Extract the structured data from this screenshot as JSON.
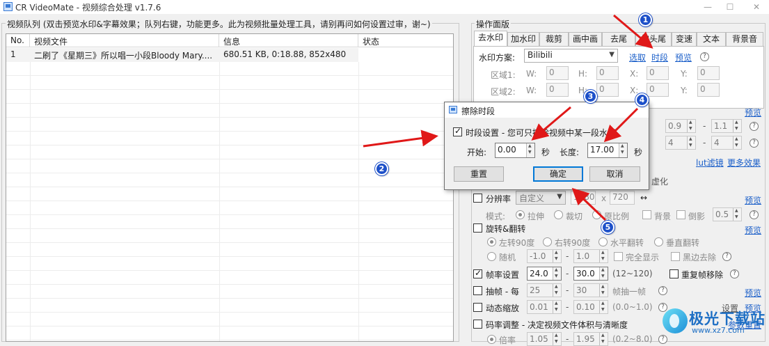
{
  "window": {
    "title": "CR VideoMate - 视频综合处理 v1.7.6",
    "minimize": "—",
    "maximize": "☐",
    "close": "✕"
  },
  "queue": {
    "title": "视频队列 (双击预览水印&字幕效果；队列右键，功能更多。此为视频批量处理工具，请别再问如何设置过审，谢~)",
    "columns": [
      "No.",
      "视频文件",
      "信息",
      "状态"
    ],
    "rows": [
      {
        "no": "1",
        "file": "二刷了《星期三》所以唱一小段Bloody Mary....",
        "info": "680.51 KB, 0:18.88, 852x480",
        "status": ""
      }
    ]
  },
  "ops": {
    "title": "操作面版",
    "tabs": [
      "去水印",
      "加水印",
      "裁剪",
      "画中画",
      "去尾",
      "加头尾",
      "变速",
      "文本",
      "背景音"
    ],
    "active_tab": "去水印",
    "watermark": {
      "scheme_label": "水印方案:",
      "scheme_value": "Bilibili",
      "pick_link": "选取",
      "period_link": "时段",
      "preview_link": "预览",
      "area1_label": "区域1:",
      "area2_label": "区域2:",
      "w_label": "W:",
      "h_label": "H:",
      "x_label": "X:",
      "y_label": "Y:",
      "zero": "0"
    },
    "preview": "预览",
    "value_09": "0.9",
    "value_11": "1.1",
    "value_4a": "4",
    "value_4b": "4",
    "lut_link": "lut滤镜",
    "more_effects_link": "更多效果",
    "blur_partial": "虚化",
    "resolution": {
      "label": "分辨率",
      "mode": "自定义",
      "w": "1280",
      "x": "x",
      "h": "720",
      "swap": "↔"
    },
    "mode": {
      "label": "模式:",
      "stretch": "拉伸",
      "crop": "裁切",
      "ratio": "原比例",
      "bg": "背景",
      "shadow": "倒影",
      "shadow_value": "0.5"
    },
    "rotate": {
      "label": "旋转&翻转",
      "left90": "左转90度",
      "right90": "右转90度",
      "hflip": "水平翻转",
      "vflip": "垂直翻转",
      "random": "随机",
      "min": "-1.0",
      "max": "1.0",
      "full": "完全显示",
      "black": "黑边去除"
    },
    "framerate": {
      "label": "帧率设置",
      "min": "24.0",
      "max": "30.0",
      "range": "(12~120)",
      "dup": "重复帧移除"
    },
    "extract": {
      "label": "抽帧 - 每",
      "a": "25",
      "b": "30",
      "suffix": "帧抽一帧"
    },
    "zoom": {
      "label": "动态缩放",
      "a": "0.01",
      "b": "0.10",
      "range": "(0.0~1.0)"
    },
    "bitrate": {
      "label": "码率调整 - 决定视频文件体积与清晰度"
    },
    "speed": {
      "label": "倍率",
      "a": "1.05",
      "b": "1.95",
      "range": "(0.2~8.0)"
    },
    "settings_link": "设置",
    "preview2": "预览",
    "restore": "参数重置"
  },
  "dialog": {
    "title": "擦除时段",
    "checkbox_label": "时段设置 - 您可只擦除视频中某一段水印",
    "start_label": "开始:",
    "start_value": "0.00",
    "sec1": "秒",
    "length_label": "长度:",
    "length_value": "17.00",
    "sec2": "秒",
    "reset": "重置",
    "ok": "确定",
    "cancel": "取消"
  },
  "badges": [
    "1",
    "2",
    "3",
    "4",
    "5"
  ],
  "watermark_logo": {
    "title": "极光下载站",
    "url": "www.xz7.com"
  },
  "colors": {
    "badge": "#1d50c9",
    "arrow": "#e01818",
    "link": "#1b5fc9"
  }
}
